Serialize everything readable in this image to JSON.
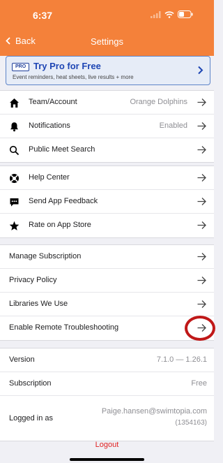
{
  "status_bar": {
    "time": "6:37"
  },
  "nav": {
    "back_label": "Back",
    "title": "Settings"
  },
  "promo": {
    "badge": "PRO",
    "title": "Try Pro for Free",
    "subtitle": "Event reminders, heat sheets, live results + more"
  },
  "group1": [
    {
      "icon": "home-icon",
      "label": "Team/Account",
      "value": "Orange Dolphins"
    },
    {
      "icon": "bell-icon",
      "label": "Notifications",
      "value": "Enabled"
    },
    {
      "icon": "search-icon",
      "label": "Public Meet Search",
      "value": ""
    }
  ],
  "group2": [
    {
      "icon": "lifebuoy-icon",
      "label": "Help Center"
    },
    {
      "icon": "chat-icon",
      "label": "Send App Feedback"
    },
    {
      "icon": "star-icon",
      "label": "Rate on App Store"
    }
  ],
  "group3": [
    {
      "label": "Manage Subscription"
    },
    {
      "label": "Privacy Policy"
    },
    {
      "label": "Libraries We Use"
    },
    {
      "label": "Enable Remote Troubleshooting"
    }
  ],
  "info": {
    "version_label": "Version",
    "version_value": "7.1.0 — 1.26.1",
    "subscription_label": "Subscription",
    "subscription_value": "Free",
    "logged_label": "Logged in as",
    "logged_email": "Paige.hansen@swimtopia.com",
    "logged_id": "(1354163)"
  },
  "logout_label": "Logout",
  "colors": {
    "header": "#f4813a",
    "promo_title": "#1e46b4",
    "logout": "#e02020",
    "highlight": "#c01818"
  }
}
